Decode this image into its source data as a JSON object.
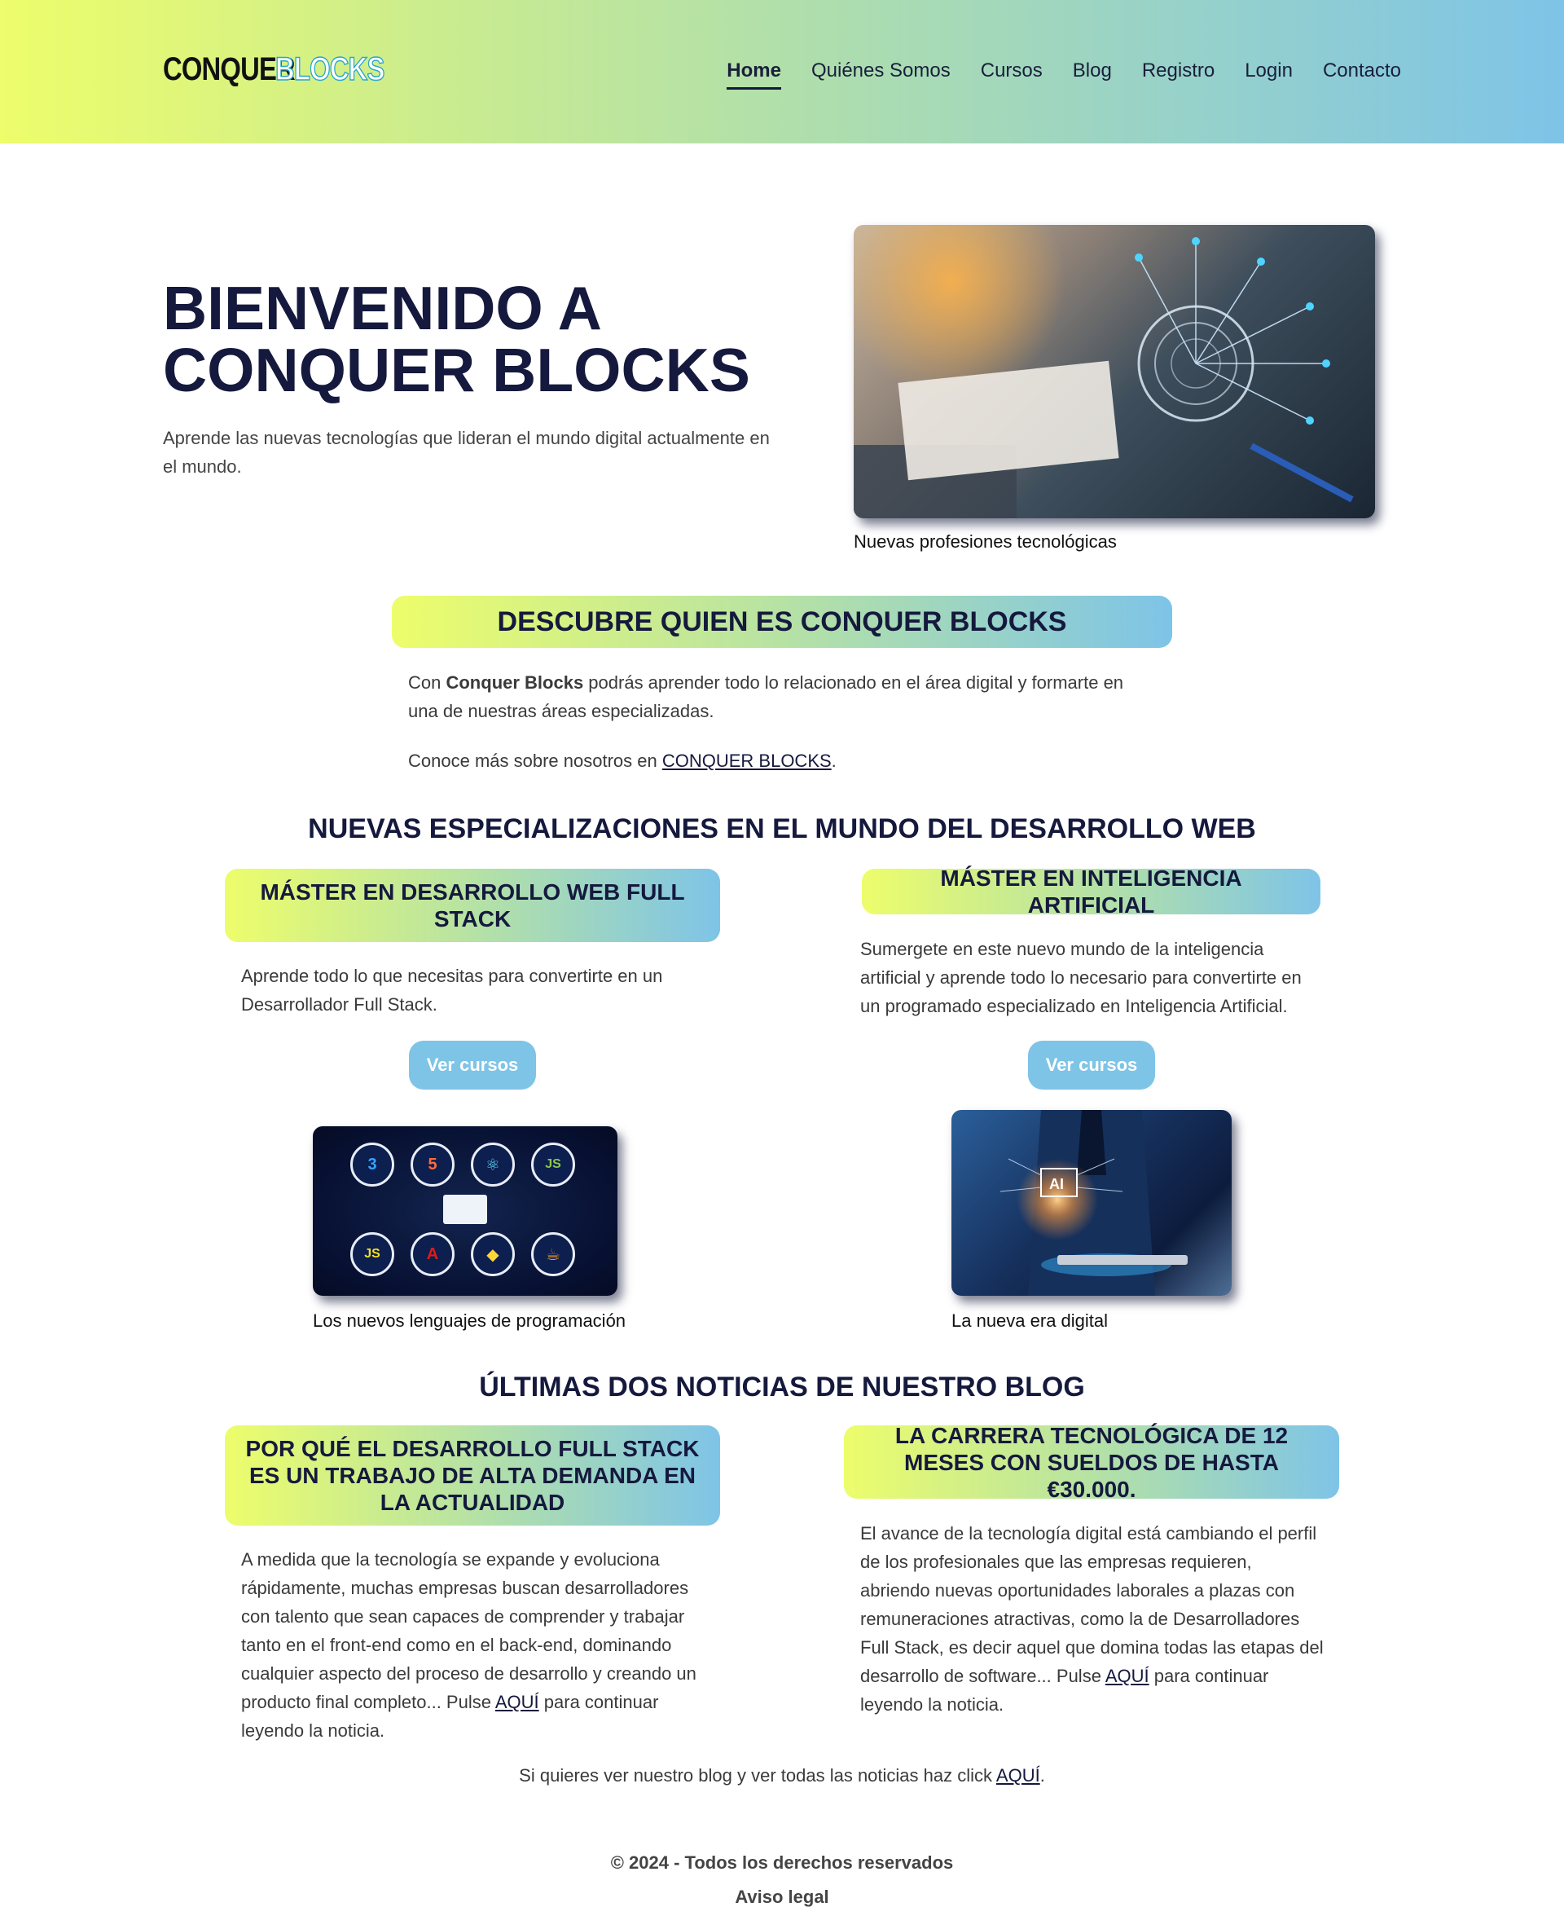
{
  "header": {
    "logo_part1": "CONQUER",
    "logo_part2": "BLOCKS",
    "nav": [
      "Home",
      "Quiénes Somos",
      "Cursos",
      "Blog",
      "Registro",
      "Login",
      "Contacto"
    ],
    "active_nav": "Home"
  },
  "hero": {
    "title_line1": "BIENVENIDO A",
    "title_line2": "CONQUER BLOCKS",
    "subtitle": "Aprende las nuevas tecnologías que lideran el mundo digital actualmente en el mundo.",
    "image_caption": "Nuevas profesiones tecnológicas"
  },
  "about": {
    "heading": "DESCUBRE QUIEN ES CONQUER BLOCKS",
    "p1_prefix": "Con ",
    "p1_bold": "Conquer Blocks",
    "p1_suffix": " podrás aprender todo lo relacionado en el área digital y formarte en una de nuestras áreas especializadas.",
    "p2_prefix": "Conoce más sobre nosotros en ",
    "p2_link": "CONQUER BLOCKS",
    "p2_suffix": "."
  },
  "specializations": {
    "title": "NUEVAS ESPECIALIZACIONES EN EL MUNDO DEL DESARROLLO WEB",
    "cards": [
      {
        "heading": "MÁSTER EN DESARROLLO WEB FULL STACK",
        "text": "Aprende todo lo que necesitas para convertirte en un Desarrollador Full Stack.",
        "button": "Ver cursos",
        "caption": "Los nuevos lenguajes de programación"
      },
      {
        "heading": "MÁSTER EN INTELIGENCIA ARTIFICIAL",
        "text": "Sumergete en este nuevo mundo de la inteligencia artificial y aprende todo lo necesario para convertirte en un programado especializado en Inteligencia Artificial.",
        "button": "Ver cursos",
        "caption": "La nueva era digital"
      }
    ]
  },
  "blog": {
    "title": "ÚLTIMAS DOS NOTICIAS DE NUESTRO BLOG",
    "posts": [
      {
        "heading": "POR QUÉ EL DESARROLLO FULL STACK ES UN TRABAJO DE ALTA DEMANDA EN LA ACTUALIDAD",
        "text": "A medida que la tecnología se expande y evoluciona rápidamente, muchas empresas buscan desarrolladores con talento que sean capaces de comprender y trabajar tanto en el front-end como en el back-end, dominando cualquier aspecto del proceso de desarrollo y creando un producto final completo... Pulse ",
        "link": "AQUÍ",
        "suffix": " para continuar leyendo la noticia."
      },
      {
        "heading": "LA CARRERA TECNOLÓGICA DE 12 MESES CON SUELDOS DE HASTA €30.000.",
        "text": "El avance de la tecnología digital está cambiando el perfil de los profesionales que las empresas requieren, abriendo nuevas oportunidades laborales a plazas con remuneraciones atractivas, como la de Desarrolladores Full Stack, es decir aquel que domina todas las etapas del desarrollo de software... Pulse ",
        "link": "AQUÍ",
        "suffix": " para continuar leyendo la noticia."
      }
    ],
    "all_prefix": "Si quieres ver nuestro blog y ver todas las noticias haz click ",
    "all_link": "AQUÍ",
    "all_suffix": "."
  },
  "footer": {
    "copyright": "© 2024 - Todos los derechos reservados",
    "legal": "Aviso legal"
  },
  "colors": {
    "accent_yellow": "#edfd6b",
    "accent_blue": "#7ec4e7",
    "navy": "#15193d"
  },
  "tech_icons": [
    "css3-icon",
    "html5-icon",
    "react-icon",
    "nodejs-icon",
    "javascript-icon",
    "angular-icon",
    "python-icon",
    "java-icon"
  ]
}
